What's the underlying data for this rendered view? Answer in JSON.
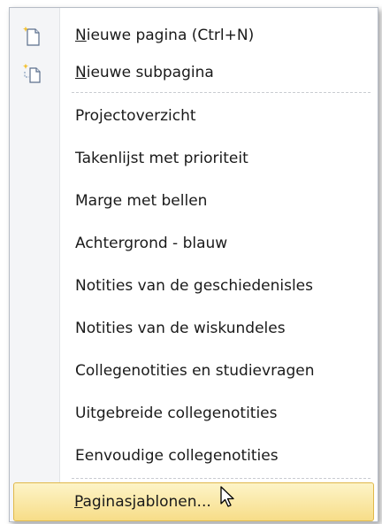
{
  "menu": {
    "new_page": {
      "mnemonic": "N",
      "rest": "ieuwe pagina  (Ctrl+N)"
    },
    "new_subpage": {
      "mnemonic": "N",
      "rest": "ieuwe subpagina"
    },
    "templates": [
      "Projectoverzicht",
      "Takenlijst met prioriteit",
      "Marge met bellen",
      "Achtergrond - blauw",
      "Notities van de geschiedenisles",
      "Notities van de wiskundeles",
      "Collegenotities en studievragen",
      "Uitgebreide collegenotities",
      "Eenvoudige collegenotities"
    ],
    "page_templates": {
      "mnemonic": "P",
      "rest": "aginasjablonen..."
    }
  },
  "colors": {
    "hover_top": "#fdf4c8",
    "hover_bottom": "#f7dd88",
    "hover_border": "#e0b84a"
  },
  "icons": {
    "new_page": "new-page-icon",
    "new_subpage": "new-subpage-icon",
    "cursor": "mouse-cursor-icon"
  }
}
